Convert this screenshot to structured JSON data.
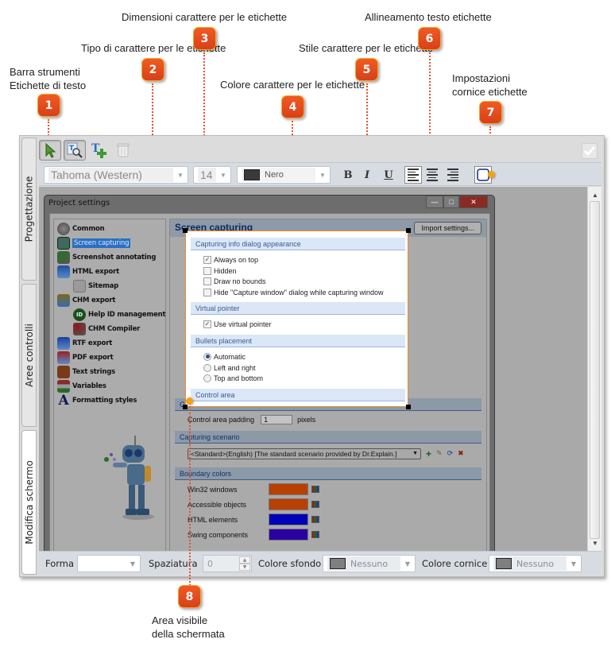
{
  "callouts": [
    {
      "num": "1",
      "label": "Barra strumenti\nEtichette di testo",
      "line1": "Barra strumenti",
      "line2": "Etichette di testo"
    },
    {
      "num": "2",
      "label": "Tipo di carattere per le etichette"
    },
    {
      "num": "3",
      "label": "Dimensioni carattere per le etichette"
    },
    {
      "num": "4",
      "label": "Colore carattere per le etichette"
    },
    {
      "num": "5",
      "label": "Stile carattere per le etichette"
    },
    {
      "num": "6",
      "label": "Allineamento testo etichette"
    },
    {
      "num": "7",
      "line1": "Impostazioni",
      "line2": "cornice etichette"
    },
    {
      "num": "8",
      "line1": "Area visibile",
      "line2": "della schermata"
    }
  ],
  "side_tabs": [
    {
      "label": "Progettazione",
      "active": false
    },
    {
      "label": "Aree controlli",
      "active": false
    },
    {
      "label": "Modifica schermo",
      "active": true
    }
  ],
  "toolbar": {
    "tools": [
      {
        "icon": "select-arrow-icon",
        "pressed": true
      },
      {
        "icon": "zoom-text-icon",
        "pressed": true
      },
      {
        "icon": "add-text-icon",
        "pressed": false
      },
      {
        "icon": "delete-trash-icon",
        "pressed": false,
        "disabled": true
      }
    ],
    "confirm_icon": "checkmark-icon"
  },
  "format_bar": {
    "font_family": "Tahoma (Western)",
    "font_size": "14",
    "font_color_name": "Nero",
    "font_color": "#333333",
    "bold_label": "B",
    "italic_label": "I",
    "underline_label": "U",
    "alignment": "left"
  },
  "screenshot": {
    "window_title": "Project settings",
    "tree": [
      {
        "label": "Common",
        "indent": 0
      },
      {
        "label": "Screen capturing",
        "indent": 0,
        "selected": true
      },
      {
        "label": "Screenshot annotating",
        "indent": 0
      },
      {
        "label": "HTML export",
        "indent": 0
      },
      {
        "label": "Sitemap",
        "indent": 1
      },
      {
        "label": "CHM export",
        "indent": 0
      },
      {
        "label": "Help ID management",
        "indent": 1
      },
      {
        "label": "CHM Compiler",
        "indent": 1
      },
      {
        "label": "RTF export",
        "indent": 0
      },
      {
        "label": "PDF export",
        "indent": 0
      },
      {
        "label": "Text strings",
        "indent": 0
      },
      {
        "label": "Variables",
        "indent": 0
      },
      {
        "label": "Formatting styles",
        "indent": 0
      }
    ],
    "panel_title": "Screen capturing",
    "import_button": "Import settings...",
    "sections": {
      "capturing_info": "Capturing info dialog appearance",
      "virtual_pointer": "Virtual pointer",
      "bullets": "Bullets placement",
      "control_area": "Control area",
      "scenario": "Capturing scenario",
      "boundary": "Boundary colors"
    },
    "checkboxes": [
      {
        "label": "Always on top",
        "checked": true
      },
      {
        "label": "Hidden",
        "checked": false
      },
      {
        "label": "Draw no bounds",
        "checked": false
      },
      {
        "label": "Hide \"Capture window\" dialog while capturing window",
        "checked": false
      }
    ],
    "virtual_pointer": {
      "label": "Use virtual pointer",
      "checked": true
    },
    "radios": [
      {
        "label": "Automatic",
        "checked": true
      },
      {
        "label": "Left and right",
        "checked": false
      },
      {
        "label": "Top and bottom",
        "checked": false
      }
    ],
    "control_padding": {
      "label": "Control area padding",
      "value": "1",
      "unit": "pixels"
    },
    "scenario_value": "<Standard>(English) [The standard scenario provided by Dr.Explain.]",
    "boundary_colors": [
      {
        "label": "Win32 windows",
        "color": "#b84000"
      },
      {
        "label": "Accessible objects",
        "color": "#b84000"
      },
      {
        "label": "HTML elements",
        "color": "#0000b8"
      },
      {
        "label": "Swing components",
        "color": "#2a00a0"
      }
    ]
  },
  "bottom_bar": {
    "shape_label": "Forma",
    "shape_value": "",
    "spacing_label": "Spaziatura",
    "spacing_value": "0",
    "bg_color_label": "Colore sfondo",
    "bg_color_value": "Nessuno",
    "frame_color_label": "Colore cornice",
    "frame_color_value": "Nessuno"
  }
}
